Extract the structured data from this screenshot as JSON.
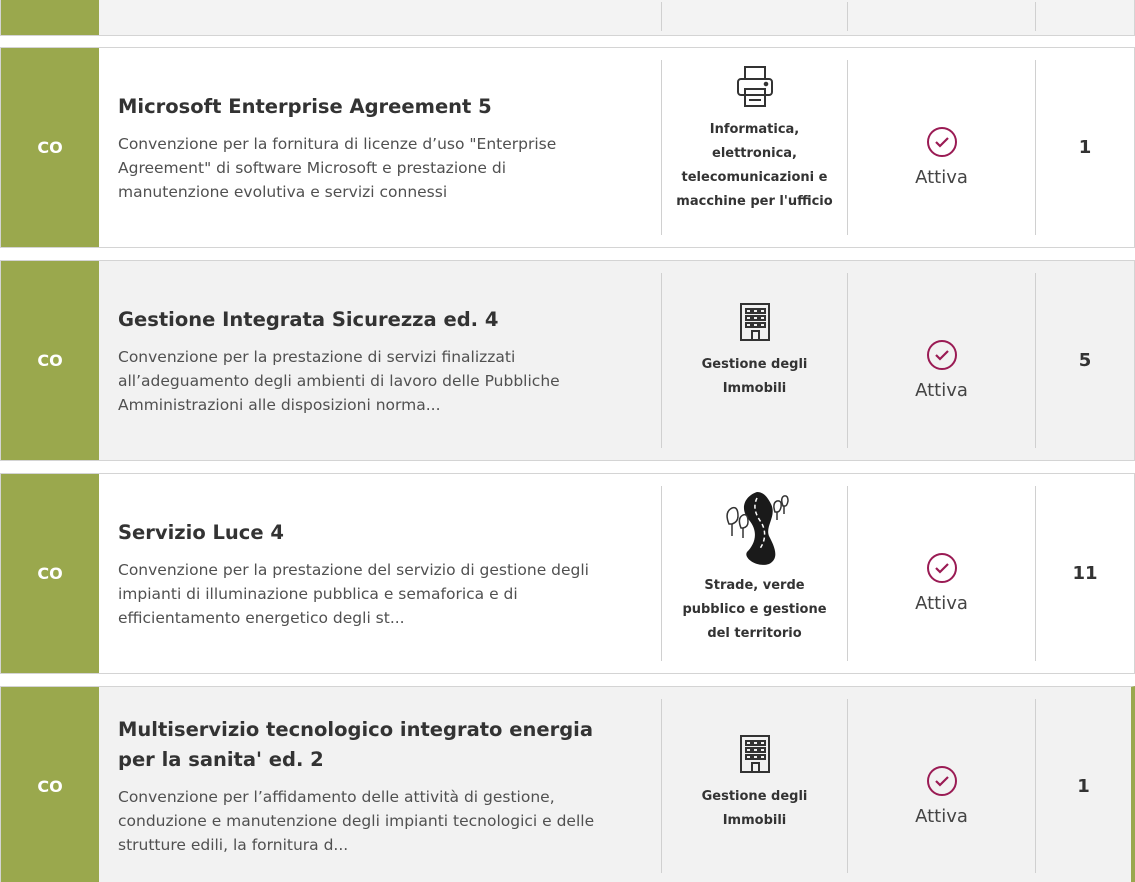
{
  "rows": [
    {
      "tag": "CO",
      "title": "Microsoft Enterprise Agreement 5",
      "description": "Convenzione per la fornitura di licenze d’uso \"Enterprise Agreement\" di software Microsoft e prestazione di manutenzione evolutiva e servizi connessi",
      "category": "Informatica, elettronica, telecomunicazioni e macchine per l'ufficio",
      "category_icon": "printer-icon",
      "status": "Attiva",
      "count": "1"
    },
    {
      "tag": "CO",
      "title": "Gestione Integrata Sicurezza ed. 4",
      "description": "Convenzione per la prestazione di servizi finalizzati all’adeguamento degli ambienti di lavoro delle Pubbliche Amministrazioni alle disposizioni norma...",
      "category": "Gestione degli Immobili",
      "category_icon": "building-icon",
      "status": "Attiva",
      "count": "5"
    },
    {
      "tag": "CO",
      "title": "Servizio Luce 4",
      "description": "Convenzione per la prestazione del servizio di gestione degli impianti di illuminazione pubblica e semaforica e di efficientamento energetico degli st...",
      "category": "Strade, verde pubblico e gestione del territorio",
      "category_icon": "road-trees-icon",
      "status": "Attiva",
      "count": "11"
    },
    {
      "tag": "CO",
      "title": "Multiservizio tecnologico integrato energia per la sanita' ed. 2",
      "description": "Convenzione per l’affidamento delle attività di gestione, conduzione e manutenzione degli impianti tecnologici e delle strutture edili, la fornitura d...",
      "category": "Gestione degli Immobili",
      "category_icon": "building-icon",
      "status": "Attiva",
      "count": "1"
    }
  ],
  "colors": {
    "accent": "#9aa84d",
    "status_icon": "#9a1b54"
  }
}
